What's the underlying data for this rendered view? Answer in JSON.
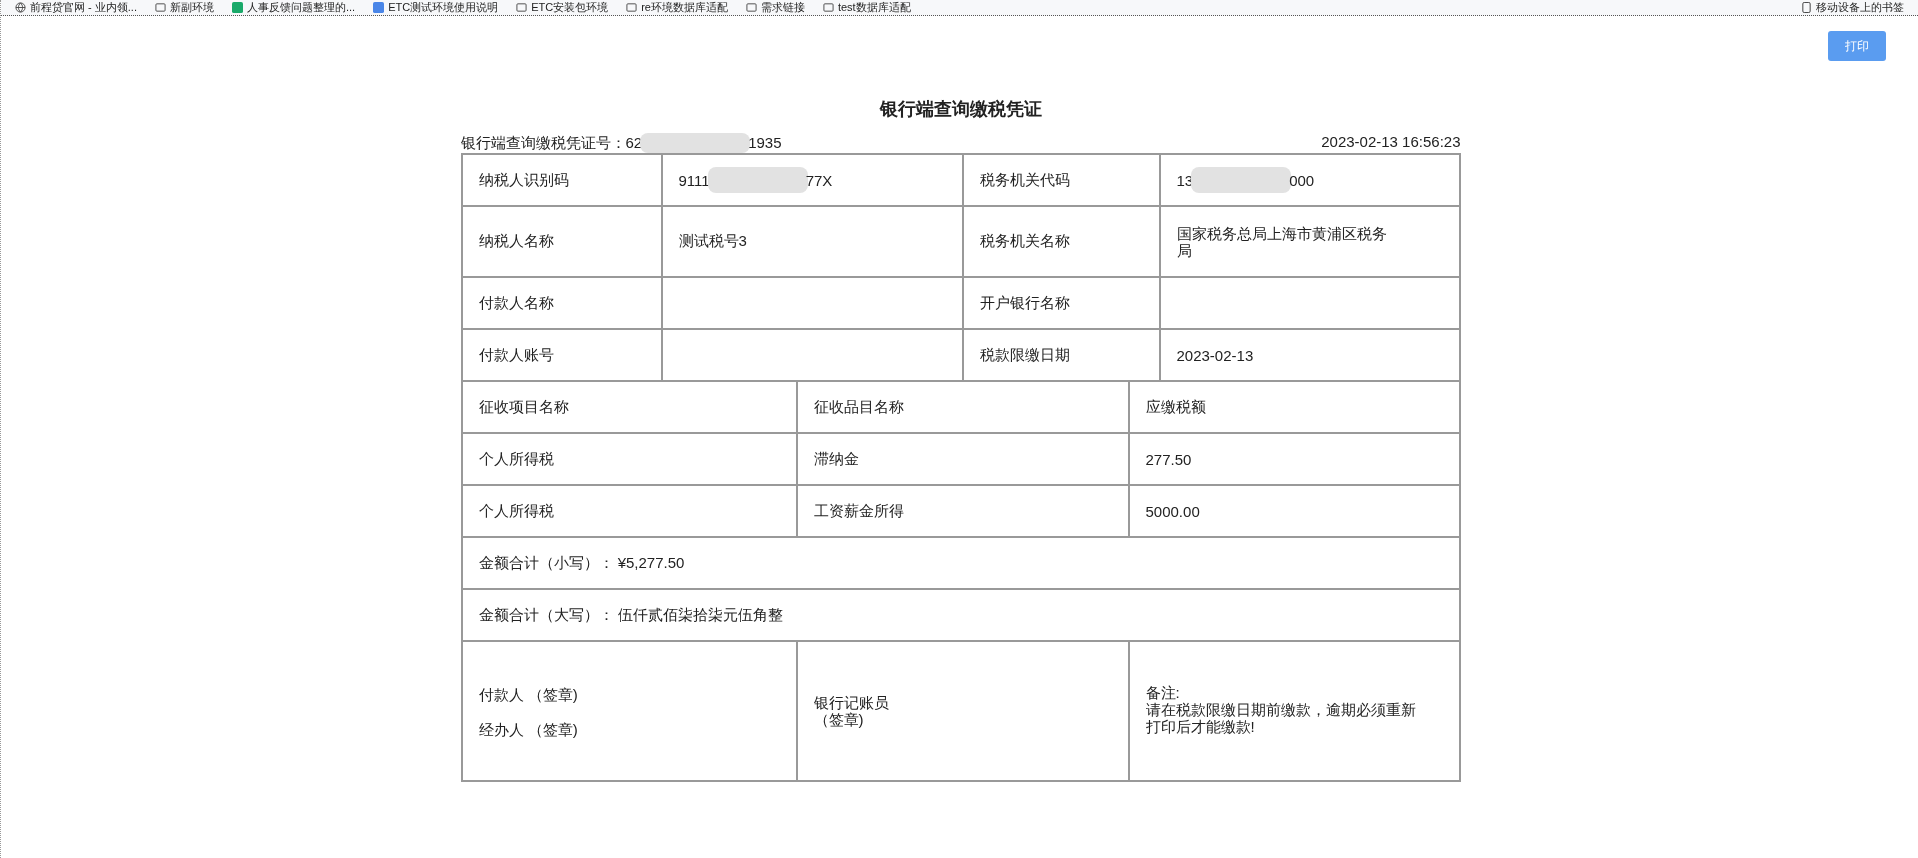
{
  "bookmarks": [
    {
      "label": "前程贷官网 - 业内领...",
      "kind": "globe"
    },
    {
      "label": "新副环境",
      "kind": "folder"
    },
    {
      "label": "人事反馈问题整理的...",
      "kind": "green"
    },
    {
      "label": "ETC测试环境使用说明",
      "kind": "blue"
    },
    {
      "label": "ETC安装包环境",
      "kind": "folder"
    },
    {
      "label": "re环境数据库适配",
      "kind": "folder"
    },
    {
      "label": "需求链接",
      "kind": "folder"
    },
    {
      "label": "test数据库适配",
      "kind": "folder"
    }
  ],
  "mobile_bookmarks": "移动设备上的书签",
  "print_button": "打印",
  "title": "银行端查询缴税凭证",
  "voucher": {
    "label": "银行端查询缴税凭证号：62",
    "visible_end": "1935"
  },
  "timestamp": "2023-02-13 16:56:23",
  "info_rows": [
    [
      {
        "text": "纳税人识别码"
      },
      {
        "text": "9111",
        "visible_end": "77X",
        "redacted": true
      },
      {
        "text": "税务机关代码"
      },
      {
        "text": "13",
        "visible_end": "000",
        "redacted": true
      }
    ],
    [
      {
        "text": "纳税人名称"
      },
      {
        "text": "测试税号3"
      },
      {
        "text": "税务机关名称"
      },
      {
        "text": "国家税务总局上海市黄浦区税务局"
      }
    ],
    [
      {
        "text": "付款人名称"
      },
      {
        "text": ""
      },
      {
        "text": "开户银行名称"
      },
      {
        "text": ""
      }
    ],
    [
      {
        "text": "付款人账号"
      },
      {
        "text": ""
      },
      {
        "text": "税款限缴日期"
      },
      {
        "text": "2023-02-13"
      }
    ]
  ],
  "item_columns": [
    "征收项目名称",
    "征收品目名称",
    "应缴税额"
  ],
  "item_rows": [
    [
      "个人所得税",
      "滞纳金",
      "277.50"
    ],
    [
      "个人所得税",
      "工资薪金所得",
      "5000.00"
    ]
  ],
  "total_small": {
    "label": "金额合计（小写）：",
    "value": "¥5,277.50"
  },
  "total_big": {
    "label": "金额合计（大写）：",
    "value": "伍仟贰佰柒拾柒元伍角整"
  },
  "signatures": {
    "payer": "付款人 （签章)",
    "handler": "经办人 （签章)",
    "clerk": "银行记账员",
    "clerk_seal": "（签章)",
    "note_label": "备注:",
    "note": "请在税款限缴日期前缴款，逾期必须重新打印后才能缴款!"
  }
}
